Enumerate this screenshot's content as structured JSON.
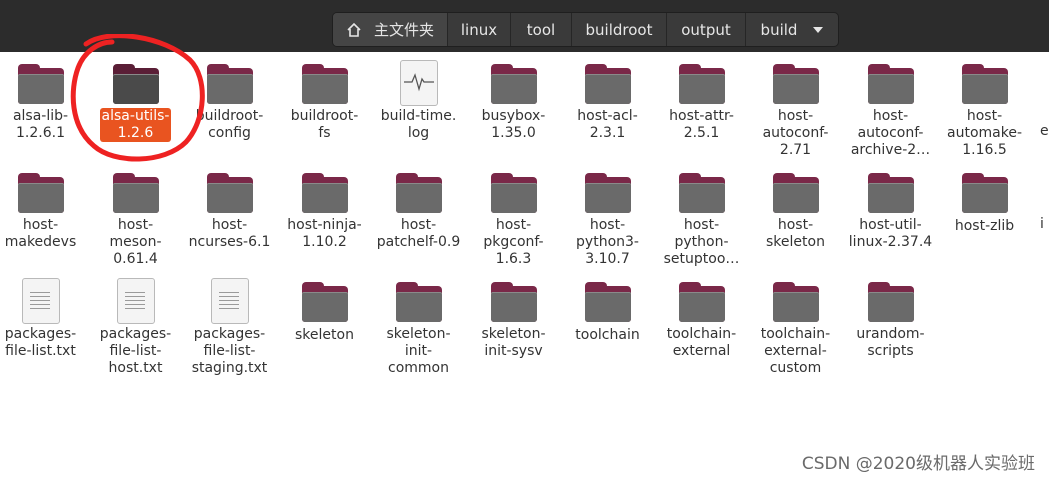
{
  "breadcrumb": {
    "home": "主文件夹",
    "items": [
      "linux",
      "tool",
      "buildroot",
      "output",
      "build"
    ]
  },
  "rows": [
    [
      {
        "label": "alsa-lib-\n1.2.6.1",
        "type": "folder"
      },
      {
        "label": "alsa-utils-\n1.2.6",
        "type": "folder",
        "selected": true
      },
      {
        "label": "buildroot-\nconfig",
        "type": "folder"
      },
      {
        "label": "buildroot-\nfs",
        "type": "folder"
      },
      {
        "label": "build-time.\nlog",
        "type": "log"
      },
      {
        "label": "busybox-\n1.35.0",
        "type": "folder"
      },
      {
        "label": "host-acl-\n2.3.1",
        "type": "folder"
      },
      {
        "label": "host-attr-\n2.5.1",
        "type": "folder"
      },
      {
        "label": "host-\nautoconf-\n2.71",
        "type": "folder"
      },
      {
        "label": "host-\nautoconf-\narchive-2…",
        "type": "folder"
      },
      {
        "label": "host-\nautomake-\n1.16.5",
        "type": "folder"
      }
    ],
    [
      {
        "label": "host-\nmakedevs",
        "type": "folder"
      },
      {
        "label": "host-\nmeson-\n0.61.4",
        "type": "folder"
      },
      {
        "label": "host-\nncurses-6.1",
        "type": "folder"
      },
      {
        "label": "host-ninja-\n1.10.2",
        "type": "folder"
      },
      {
        "label": "host-\npatchelf-0.9",
        "type": "folder"
      },
      {
        "label": "host-\npkgconf-\n1.6.3",
        "type": "folder"
      },
      {
        "label": "host-\npython3-\n3.10.7",
        "type": "folder"
      },
      {
        "label": "host-\npython-\nsetuptoo…",
        "type": "folder"
      },
      {
        "label": "host-\nskeleton",
        "type": "folder"
      },
      {
        "label": "host-util-\nlinux-2.37.4",
        "type": "folder"
      },
      {
        "label": "host-zlib",
        "type": "folder"
      }
    ],
    [
      {
        "label": "packages-\nfile-list.txt",
        "type": "text"
      },
      {
        "label": "packages-\nfile-list-\nhost.txt",
        "type": "text"
      },
      {
        "label": "packages-\nfile-list-\nstaging.txt",
        "type": "text"
      },
      {
        "label": "skeleton",
        "type": "folder"
      },
      {
        "label": "skeleton-\ninit-\ncommon",
        "type": "folder"
      },
      {
        "label": "skeleton-\ninit-sysv",
        "type": "folder"
      },
      {
        "label": "toolchain",
        "type": "folder"
      },
      {
        "label": "toolchain-\nexternal",
        "type": "folder"
      },
      {
        "label": "toolchain-\nexternal-\ncustom",
        "type": "folder"
      },
      {
        "label": "urandom-\nscripts",
        "type": "folder"
      }
    ]
  ],
  "cutoff": [
    "e",
    "i"
  ],
  "watermark": "CSDN @2020级机器人实验班",
  "colors": {
    "accent": "#e95420",
    "annotation": "#ee2222"
  }
}
